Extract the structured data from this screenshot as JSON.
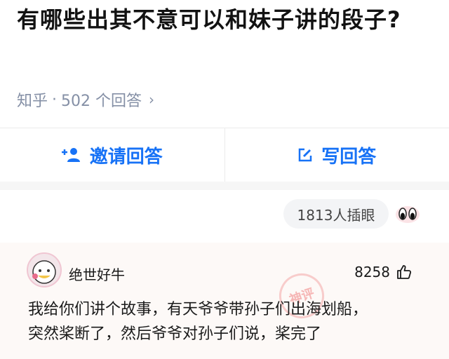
{
  "question": {
    "title": "有哪些出其不意可以和妹子讲的段子?",
    "source": "知乎",
    "separator": "·",
    "answers_count": "502 个回答"
  },
  "actions": {
    "invite_label": "邀请回答",
    "write_label": "写回答"
  },
  "cutin": {
    "label": "1813人插眼"
  },
  "answer": {
    "author": "绝世好牛",
    "likes": "8258",
    "stamp_text": "神评",
    "lines": [
      "我给你们讲个故事，有天爷爷带孙子们出海划船，",
      "突然桨断了，然后爷爷对孙子们说，桨完了"
    ]
  },
  "colors": {
    "accent": "#1772f6",
    "muted": "#8590a6"
  },
  "icons": [
    "add-person-icon",
    "edit-icon",
    "chevron-right-icon",
    "eyes-icon",
    "thumbs-up-icon"
  ]
}
